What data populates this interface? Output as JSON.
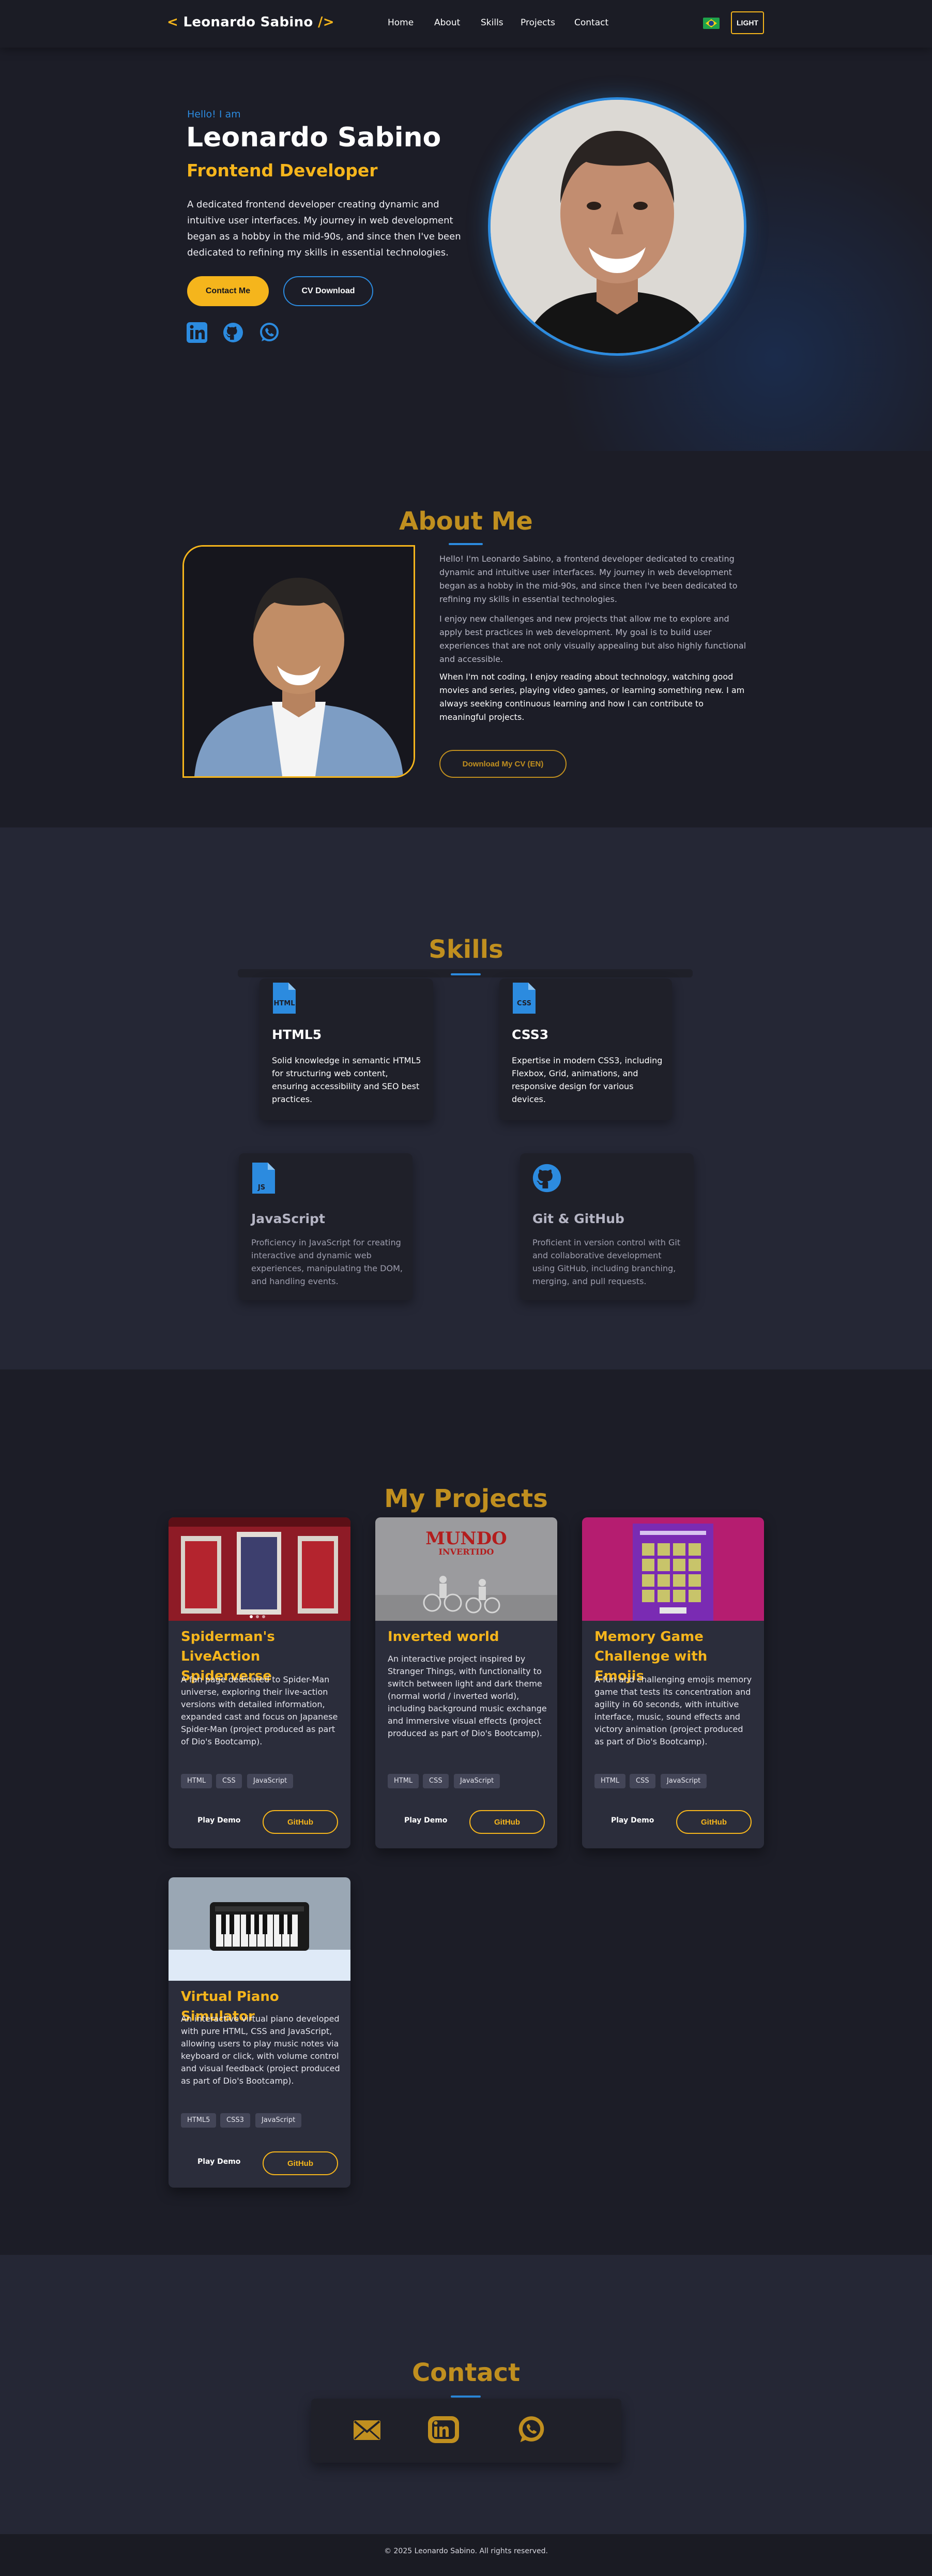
{
  "header": {
    "logo_open": "<",
    "logo_name": "Leonardo Sabino",
    "logo_close": "/>",
    "nav": [
      "Home",
      "About",
      "Skills",
      "Projects",
      "Contact"
    ],
    "theme_button": "LIGHT"
  },
  "hero": {
    "greeting": "Hello! I am",
    "name": "Leonardo Sabino",
    "role": "Frontend Developer",
    "intro": "A dedicated frontend developer creating dynamic and intuitive user interfaces. My journey in web development began as a hobby in the mid-90s, and since then I've been dedicated to refining my skills in essential technologies.",
    "contact_button": "Contact Me",
    "cv_button": "CV Download",
    "socials": [
      "linkedin-icon",
      "github-icon",
      "whatsapp-icon"
    ]
  },
  "about": {
    "title": "About Me",
    "p1": "Hello! I'm Leonardo Sabino, a frontend developer dedicated to creating dynamic and intuitive user interfaces. My journey in web development began as a hobby in the mid-90s, and since then I've been dedicated to refining my skills in essential technologies.",
    "p2": "I enjoy new challenges and new projects that allow me to explore and apply best practices in web development. My goal is to build user experiences that are not only visually appealing but also highly functional and accessible.",
    "p3": "When I'm not coding, I enjoy reading about technology, watching good movies and series, playing video games, or learning something new. I am always seeking continuous learning and how I can contribute to meaningful projects.",
    "cv_button": "Download My CV (EN)"
  },
  "skills": {
    "title": "Skills",
    "items": [
      {
        "name": "HTML5",
        "icon": "html-file-icon",
        "badge": "HTML",
        "desc": "Solid knowledge in semantic HTML5 for structuring web content, ensuring accessibility and SEO best practices."
      },
      {
        "name": "CSS3",
        "icon": "css-file-icon",
        "badge": "CSS",
        "desc": "Expertise in modern CSS3, including Flexbox, Grid, animations, and responsive design for various devices."
      },
      {
        "name": "JavaScript",
        "icon": "js-file-icon",
        "badge": "JS",
        "desc": "Proficiency in JavaScript for creating interactive and dynamic web experiences, manipulating the DOM, and handling events."
      },
      {
        "name": "Git & GitHub",
        "icon": "github-icon",
        "badge": "",
        "desc": "Proficient in version control with Git and collaborative development using GitHub, including branching, merging, and pull requests."
      }
    ]
  },
  "projects": {
    "title": "My Projects",
    "play_label": "Play Demo",
    "github_label": "GitHub",
    "items": [
      {
        "title": "Spiderman's LiveAction Spiderverse",
        "desc": "A fan page dedicated to Spider-Man universe, exploring their live-action versions with detailed information, expanded cast and focus on Japanese Spider-Man (project produced as part of Dio's Bootcamp).",
        "tags": [
          "HTML",
          "CSS",
          "JavaScript"
        ]
      },
      {
        "title": "Inverted world",
        "desc": "An interactive project inspired by Stranger Things, with functionality to switch between light and dark theme (normal world / inverted world), including background music exchange and immersive visual effects (project produced as part of Dio's Bootcamp).",
        "tags": [
          "HTML",
          "CSS",
          "JavaScript"
        ],
        "thumb_title": "MUNDO",
        "thumb_sub": "INVERTIDO"
      },
      {
        "title": "Memory Game Challenge with Emojis",
        "desc": "A fun and challenging emojis memory game that tests its concentration and agility in 60 seconds, with intuitive interface, music, sound effects and victory animation (project produced as part of Dio's Bootcamp).",
        "tags": [
          "HTML",
          "CSS",
          "JavaScript"
        ]
      },
      {
        "title": "Virtual Piano Simulator",
        "desc": "An interactive virtual piano developed with pure HTML, CSS and JavaScript, allowing users to play music notes via keyboard or click, with volume control and visual feedback (project produced as part of Dio's Bootcamp).",
        "tags": [
          "HTML5",
          "CSS3",
          "JavaScript"
        ]
      }
    ]
  },
  "contact": {
    "title": "Contact",
    "icons": [
      "email-icon",
      "linkedin-icon",
      "whatsapp-icon"
    ]
  },
  "footer": {
    "text": "© 2025 Leonardo Sabino. All rights reserved."
  },
  "colors": {
    "accent_yellow": "#f5b51c",
    "accent_blue": "#2c8bdf",
    "bg_dark": "#1c1d27",
    "bg_section": "#252735"
  }
}
